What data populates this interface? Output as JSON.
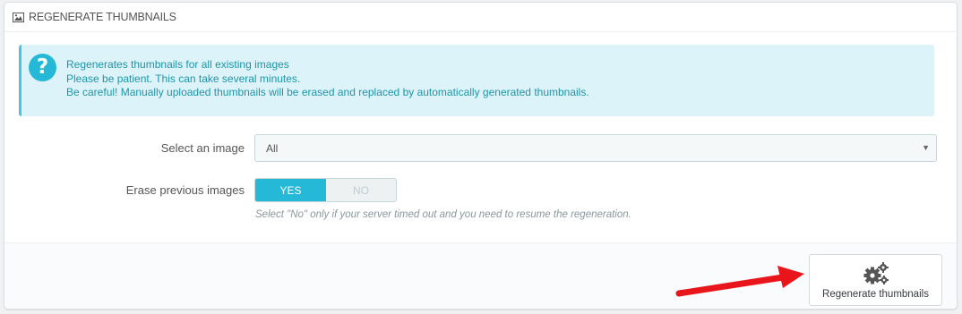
{
  "panel": {
    "title": "Regenerate thumbnails",
    "header_icon": "picture-icon"
  },
  "alert": {
    "icon": "question-circle-icon",
    "icon_glyph": "?",
    "lines": [
      "Regenerates thumbnails for all existing images",
      "Please be patient. This can take several minutes.",
      "Be careful! Manually uploaded thumbnails will be erased and replaced by automatically generated thumbnails."
    ]
  },
  "form": {
    "select_label": "Select an image",
    "select_value": "All",
    "erase_label": "Erase previous images",
    "erase_yes": "YES",
    "erase_no": "NO",
    "erase_selected": "YES",
    "help_text": "Select \"No\" only if your server timed out and you need to resume the regeneration."
  },
  "footer": {
    "regenerate_button": "Regenerate thumbnails",
    "button_icon": "cogs-icon"
  },
  "colors": {
    "accent": "#25b9d7",
    "alert_bg": "#dcf4f9",
    "alert_text": "#1e94ab",
    "arrow": "#e8161b"
  }
}
